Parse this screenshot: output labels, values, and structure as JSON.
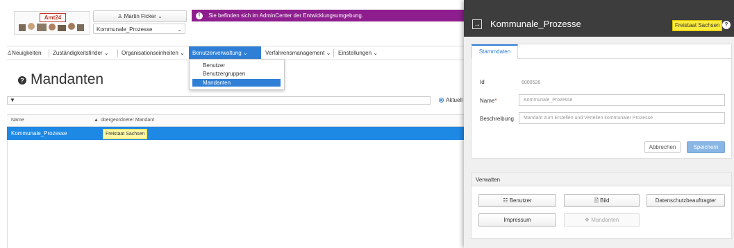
{
  "header": {
    "logo_text": "Amt24",
    "user_button": "Martin Ficker",
    "tenant_select": "Kommunale_Prozesse",
    "notice": "Sie befinden sich im AdminCenter der Entwicklungsumgebung.",
    "notice_color": "#8e1e8e"
  },
  "nav": {
    "items": [
      {
        "label": "Neuigkeiten",
        "icon": "users-icon"
      },
      {
        "label": "Zuständigkeitsfinder ⌄"
      },
      {
        "label": "Organisationseinheiten ⌄"
      },
      {
        "label": "Benutzerverwaltung ⌄"
      },
      {
        "label": "Verfahrensmanagement ⌄"
      },
      {
        "label": "Einstellungen ⌄"
      }
    ],
    "active_index": 3,
    "dropdown": [
      "Benutzer",
      "Benutzergruppen",
      "Mandanten"
    ],
    "dropdown_selected": 2
  },
  "page": {
    "title": "Mandanten",
    "radio_label": "Aktuell",
    "columns": [
      "Name",
      "übergeordneter Mandant"
    ],
    "rows": [
      {
        "name": "Kommunale_Prozesse",
        "parent": "Freistaat Sachsen"
      }
    ],
    "accent": "#1e88e5"
  },
  "panel": {
    "title": "Kommunale_Prozesse",
    "badge": "Freistaat Sachsen",
    "tab": "Stammdaten",
    "fields": {
      "id_label": "Id",
      "id_value": "6000526",
      "name_label": "Name",
      "name_required": "*",
      "name_placeholder": "Kommunale_Prozesse",
      "desc_label": "Beschreibung",
      "desc_placeholder": "Mandant zum Erstellen und Verteilen kommunaler Prozesse"
    },
    "cancel": "Abbrechen",
    "save": "Speichern",
    "manage": {
      "title": "Verwalten",
      "buttons": [
        "Benutzer",
        "Bild",
        "Datenschutzbeauftragter",
        "Impressum",
        "Mandanten"
      ]
    }
  }
}
